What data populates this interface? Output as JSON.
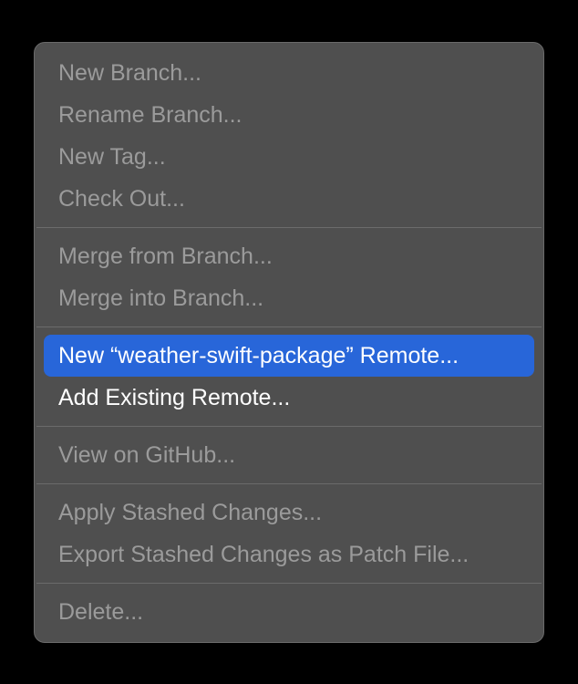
{
  "menu": {
    "groups": [
      [
        {
          "label": "New Branch...",
          "state": "disabled",
          "name": "new-branch"
        },
        {
          "label": "Rename Branch...",
          "state": "disabled",
          "name": "rename-branch"
        },
        {
          "label": "New Tag...",
          "state": "disabled",
          "name": "new-tag"
        },
        {
          "label": "Check Out...",
          "state": "disabled",
          "name": "check-out"
        }
      ],
      [
        {
          "label": "Merge from Branch...",
          "state": "disabled",
          "name": "merge-from-branch"
        },
        {
          "label": "Merge into Branch...",
          "state": "disabled",
          "name": "merge-into-branch"
        }
      ],
      [
        {
          "label": "New “weather-swift-package” Remote...",
          "state": "selected",
          "name": "new-remote"
        },
        {
          "label": "Add Existing Remote...",
          "state": "enabled",
          "name": "add-existing-remote"
        }
      ],
      [
        {
          "label": "View on GitHub...",
          "state": "disabled",
          "name": "view-on-github"
        }
      ],
      [
        {
          "label": "Apply Stashed Changes...",
          "state": "disabled",
          "name": "apply-stashed-changes"
        },
        {
          "label": "Export Stashed Changes as Patch File...",
          "state": "disabled",
          "name": "export-stashed-changes"
        }
      ],
      [
        {
          "label": "Delete...",
          "state": "disabled",
          "name": "delete"
        }
      ]
    ]
  }
}
